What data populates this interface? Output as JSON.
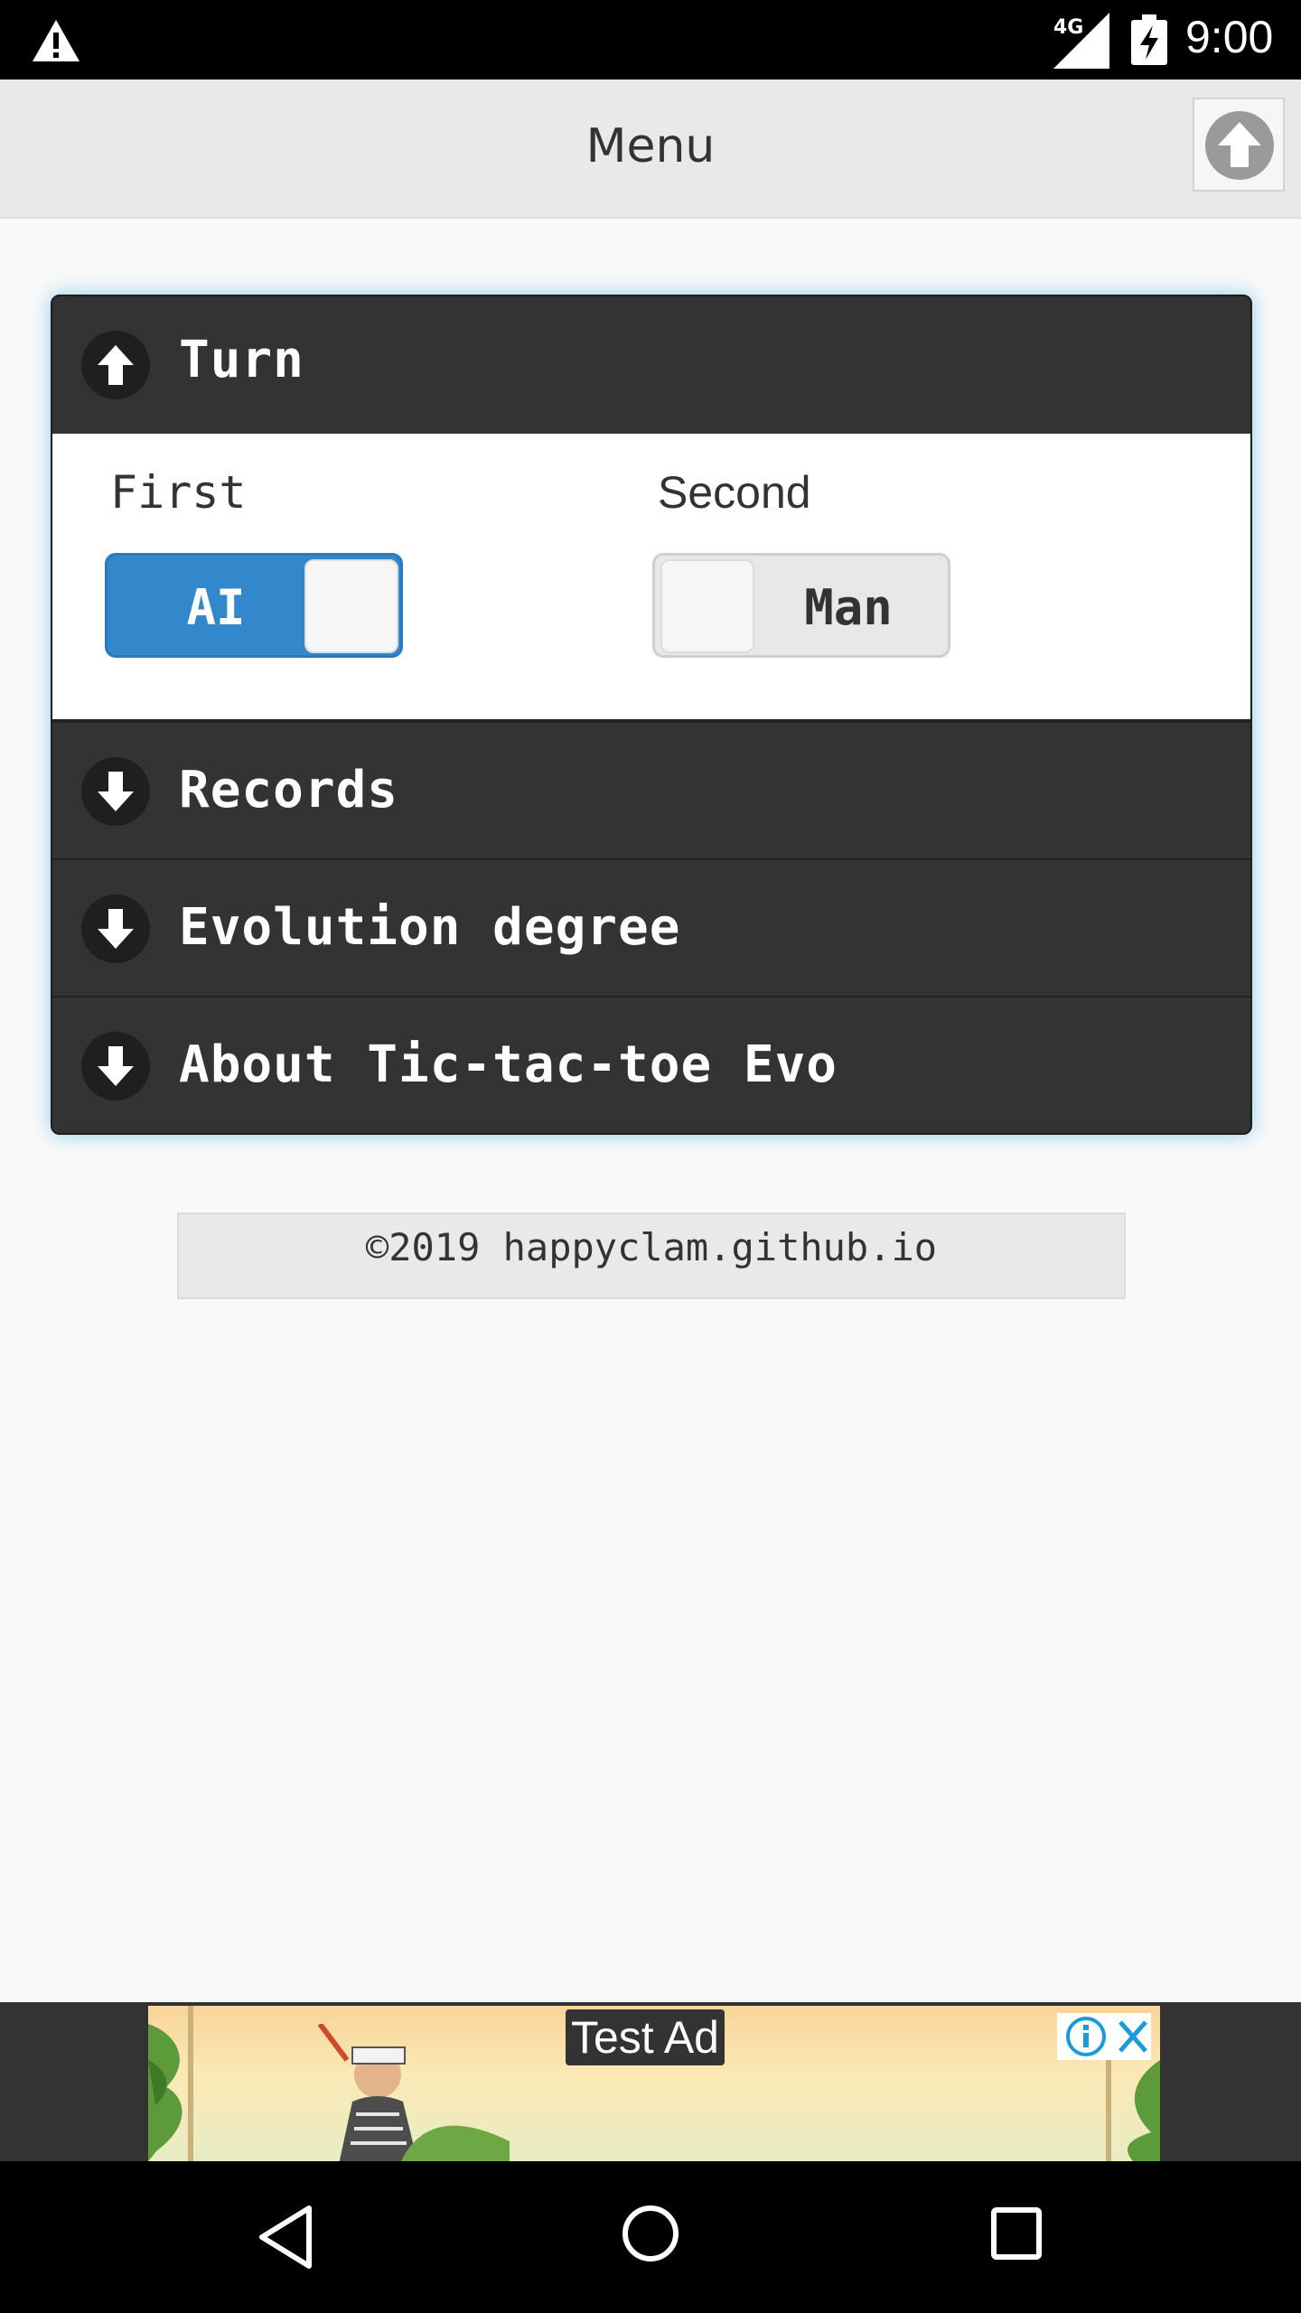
{
  "status_bar": {
    "network": "4G",
    "time": "9:00"
  },
  "header": {
    "title": "Menu"
  },
  "sections": {
    "turn": {
      "title": "Turn",
      "first_label": "First",
      "second_label": "Second",
      "first_toggle": {
        "on_label": "AI",
        "state": "on"
      },
      "second_toggle": {
        "off_label": "Man",
        "state": "off"
      }
    },
    "records": {
      "title": "Records"
    },
    "evolution": {
      "title": "Evolution degree"
    },
    "about": {
      "title": "About Tic-tac-toe Evo"
    }
  },
  "footer": {
    "copyright": "©2019 happyclam.github.io"
  },
  "ad": {
    "label": "Test Ad"
  },
  "colors": {
    "accent": "#3388cc",
    "header_bg": "#e9e9e9",
    "collapsible_bg": "#333333",
    "focus_glow": "#38aae6"
  }
}
